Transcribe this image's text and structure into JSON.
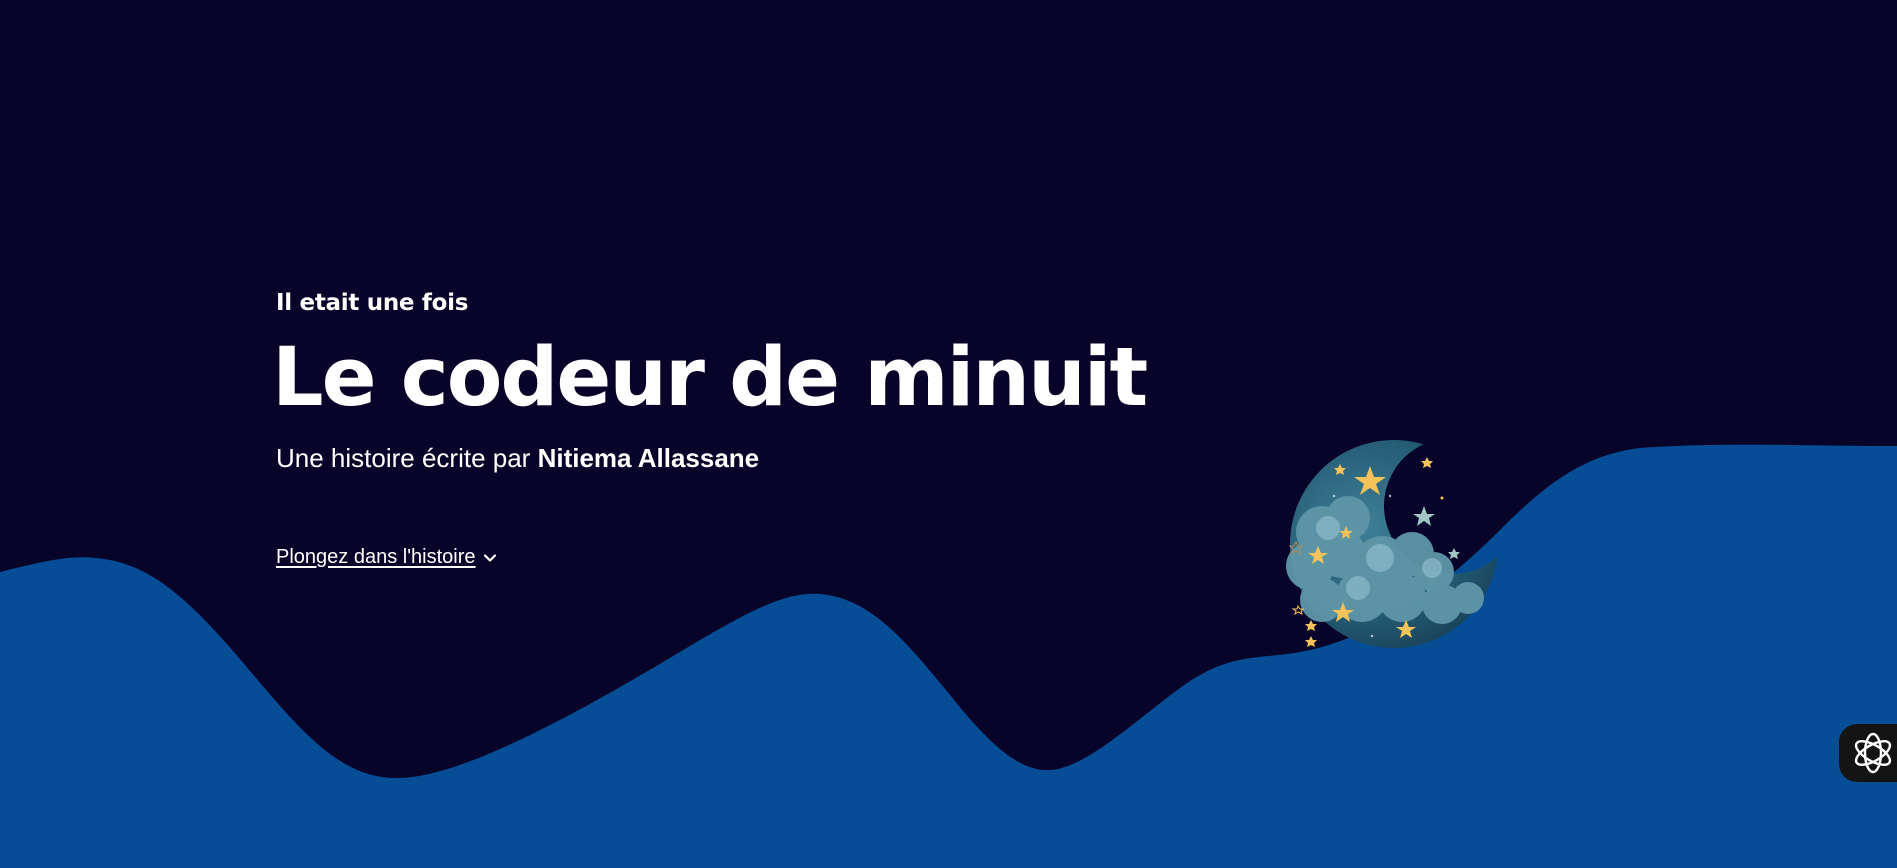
{
  "hero": {
    "eyebrow": "Il etait une fois",
    "title": "Le codeur de minuit",
    "byline_prefix": "Une histoire écrite par ",
    "author": "Nitiema Allassane"
  },
  "cta": {
    "label": "Plongez dans l'histoire",
    "icon": "chevron-down-icon"
  },
  "illustration": {
    "icon": "moon-clouds-stars-illustration"
  },
  "floating_button": {
    "icon": "assistant-logo-icon"
  },
  "colors": {
    "background": "#080328",
    "wave": "#054e96",
    "text": "#ffffff"
  }
}
